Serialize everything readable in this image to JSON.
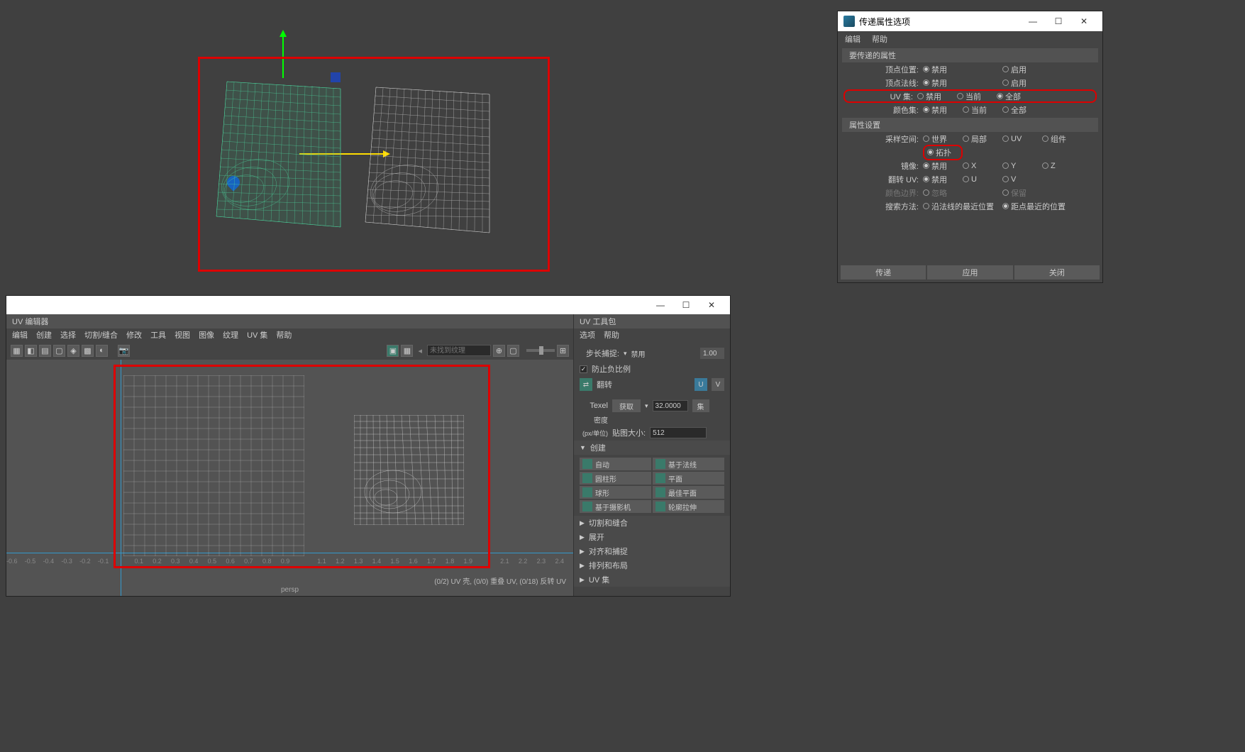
{
  "transfer_dialog": {
    "title": "传递属性选项",
    "menu": {
      "edit": "编辑",
      "help": "帮助"
    },
    "section_attributes": "要传递的属性",
    "section_settings": "属性设置",
    "labels": {
      "vertex_pos": "顶点位置:",
      "vertex_normal": "顶点法线:",
      "uv_sets": "UV 集:",
      "color_sets": "颜色集:",
      "sample_space": "采样空间:",
      "mirror": "镜像:",
      "flip_uv": "翻转 UV:",
      "color_border": "颜色边界:",
      "search_method": "搜索方法:"
    },
    "options": {
      "disable": "禁用",
      "enable": "启用",
      "current": "当前",
      "all": "全部",
      "world": "世界",
      "local": "局部",
      "uv": "UV",
      "component": "组件",
      "topology": "拓扑",
      "x": "X",
      "y": "Y",
      "z": "Z",
      "u": "U",
      "v": "V",
      "ignore": "忽略",
      "keep": "保留",
      "closest_along_normal": "沿法线的最近位置",
      "closest_to_point": "距点最近的位置"
    },
    "actions": {
      "transfer": "传递",
      "apply": "应用",
      "close": "关闭"
    }
  },
  "uv_editor": {
    "title": "UV 编辑器",
    "toolkit_title": "UV 工具包",
    "menu": {
      "edit": "编辑",
      "create": "创建",
      "select": "选择",
      "cut_sew": "切割/缝合",
      "modify": "修改",
      "tools": "工具",
      "view": "视图",
      "image": "图像",
      "texture": "纹理",
      "uv_sets": "UV 集",
      "help": "帮助",
      "options": "选项"
    },
    "search_placeholder": "未找到纹理",
    "ruler": [
      "-0.6",
      "-0.5",
      "-0.4",
      "-0.3",
      "-0.2",
      "-0.1",
      "",
      "0.1",
      "0.2",
      "0.3",
      "0.4",
      "0.5",
      "0.6",
      "0.7",
      "0.8",
      "0.9",
      "",
      "1.1",
      "1.2",
      "1.3",
      "1.4",
      "1.5",
      "1.6",
      "1.7",
      "1.8",
      "1.9",
      "",
      "2.1",
      "2.2",
      "2.3",
      "2.4"
    ],
    "status": "(0/2) UV 壳, (0/0) 重叠 UV, (0/18) 反转 UV",
    "persp": "persp"
  },
  "toolkit": {
    "step_snap": "步长捕捉:",
    "step_disable": "禁用",
    "step_val": "1.00",
    "prevent_neg": "防止负比例",
    "flip": "翻转",
    "u": "U",
    "v": "V",
    "texel_density": "Texel",
    "density2": "密度",
    "px_unit": "(px/单位)",
    "get": "获取",
    "set": "集",
    "texel_val": "32.0000",
    "map_size": "贴图大小:",
    "map_val": "512",
    "sections": {
      "create": "创建",
      "cut_sew": "切割和缝合",
      "unfold": "展开",
      "align_snap": "对齐和捕捉",
      "arrange": "排列和布局",
      "uv_sets": "UV 集"
    },
    "create": {
      "auto": "自动",
      "normal": "基于法线",
      "cylinder": "圆柱形",
      "planar": "平面",
      "sphere": "球形",
      "best_plane": "最佳平面",
      "camera": "基于摄影机",
      "contour": "轮廓拉伸"
    }
  }
}
